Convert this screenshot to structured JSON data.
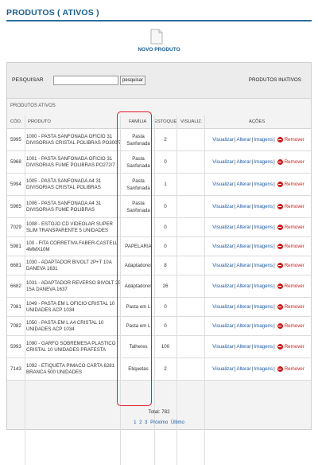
{
  "page_title": "PRODUTOS ( ATIVOS )",
  "new_product_label": "NOVO PRODUTO",
  "search": {
    "label": "PESQUISAR",
    "placeholder": "",
    "button_label": "pesquisar",
    "inactive_link": "PRODUTOS INATIVOS"
  },
  "section_label": "PRODUTOS ATIVOS",
  "table": {
    "headers": {
      "code": "CÓD.",
      "product": "PRODUTO",
      "family": "FAMÍLIA",
      "stock": "ESTOQUE",
      "view": "VISUALIZ.",
      "actions": "AÇÕES"
    },
    "actions": {
      "view": "Visualizar",
      "edit": "Alterar",
      "images": "Imagens",
      "remove": "Remover"
    },
    "rows": [
      {
        "code": "5995",
        "product": "1000 - PASTA SANFONADA OFICIO 31 DIVISORIAS CRISTAL POLIBRAS PO300/7",
        "family": "Pasta Sanfonada",
        "stock": "2"
      },
      {
        "code": "5968",
        "product": "1001 - PASTA SANFONADA OFICIO 31 DIVISORIAS FUME POLIBRAS PO272/7",
        "family": "Pasta Sanfonada",
        "stock": "0"
      },
      {
        "code": "5994",
        "product": "1005 - PASTA SANFONADA A4 31 DIVISORIAS CRISTAL POLIBRAS",
        "family": "Pasta Sanfonada",
        "stock": "1"
      },
      {
        "code": "5965",
        "product": "1006 - PASTA SANFONADA A4 31 DIVISORIAS FUME POLIBRAS",
        "family": "Pasta Sanfonada",
        "stock": "0"
      },
      {
        "code": "7029",
        "product": "1008 - ESTOJO CD VIDEOLAR SUPER SLIM TRANSPARENTE 5 UNIDADES",
        "family": "",
        "stock": "0"
      },
      {
        "code": "5981",
        "product": "100 - FITA CORRETIVA FABER-CASTELL 4MMX10M",
        "family": "PAPELARIA",
        "stock": "0"
      },
      {
        "code": "6681",
        "product": "1030 - ADAPTADOR BIVOLT 2P+T 10A DANEVA 1631",
        "family": "Adaptadores",
        "stock": "8"
      },
      {
        "code": "6682",
        "product": "1031 - ADAPTADOR REVERSO BIVOLT 2P 15A DANEVA 1637",
        "family": "Adaptadores",
        "stock": "26"
      },
      {
        "code": "7081",
        "product": "1049 - PASTA EM L OFICIO CRISTAL 10 UNIDADES ACP 1034",
        "family": "Pasta em L",
        "stock": "0"
      },
      {
        "code": "7082",
        "product": "1050 - PASTA EM L A4 CRISTAL 10 UNIDADES ACP 1034",
        "family": "Pasta em L",
        "stock": "0"
      },
      {
        "code": "5993",
        "product": "1090 - GARFO SOBREMESA PLASTICO CRISTAL 10 UNIDADES PRAFESTA",
        "family": "Talheres",
        "stock": "100"
      },
      {
        "code": "7143",
        "product": "1092 - ETIQUETA PIMACO CARTA 6281 BRANCA 500 UNIDADES",
        "family": "Etiquetas",
        "stock": "2"
      }
    ],
    "total": "Total: 782"
  },
  "pagination": {
    "pages": [
      "1",
      "2",
      "3"
    ],
    "next": "Próximo",
    "last": "Último"
  },
  "colors": {
    "title": "#1a5f8a",
    "link": "#1a5aa6",
    "remove": "#cc1a1a",
    "highlight": "#e01b2b"
  }
}
